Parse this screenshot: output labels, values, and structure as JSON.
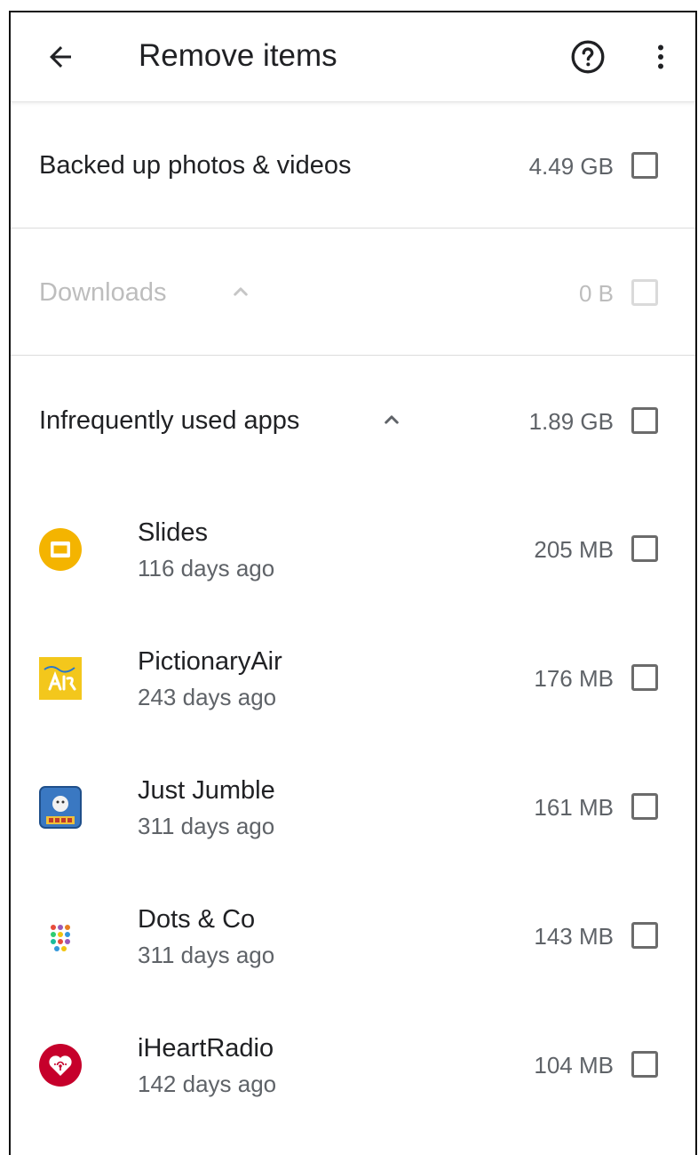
{
  "header": {
    "title": "Remove items",
    "back_icon": "arrow-left-icon",
    "help_icon": "help-circle-icon",
    "more_icon": "more-vert-icon"
  },
  "sections": {
    "backed_up": {
      "label": "Backed up photos & videos",
      "size": "4.49 GB"
    },
    "downloads": {
      "label": "Downloads",
      "size": "0 B"
    },
    "infrequent": {
      "label": "Infrequently used apps",
      "size": "1.89 GB"
    }
  },
  "apps": [
    {
      "name": "Slides",
      "last_used": "116 days ago",
      "size": "205 MB",
      "icon": "slides-icon"
    },
    {
      "name": "PictionaryAir",
      "last_used": "243 days ago",
      "size": "176 MB",
      "icon": "pictionaryair-icon"
    },
    {
      "name": "Just Jumble",
      "last_used": "311 days ago",
      "size": "161 MB",
      "icon": "just-jumble-icon"
    },
    {
      "name": "Dots & Co",
      "last_used": "311 days ago",
      "size": "143 MB",
      "icon": "dots-and-co-icon"
    },
    {
      "name": "iHeartRadio",
      "last_used": "142 days ago",
      "size": "104 MB",
      "icon": "iheartradio-icon"
    }
  ],
  "colors": {
    "slides": "#F4B400",
    "pictionary": "#F3C71C",
    "iheart": "#C6002B",
    "disabled_text": "#BDBDBD"
  }
}
